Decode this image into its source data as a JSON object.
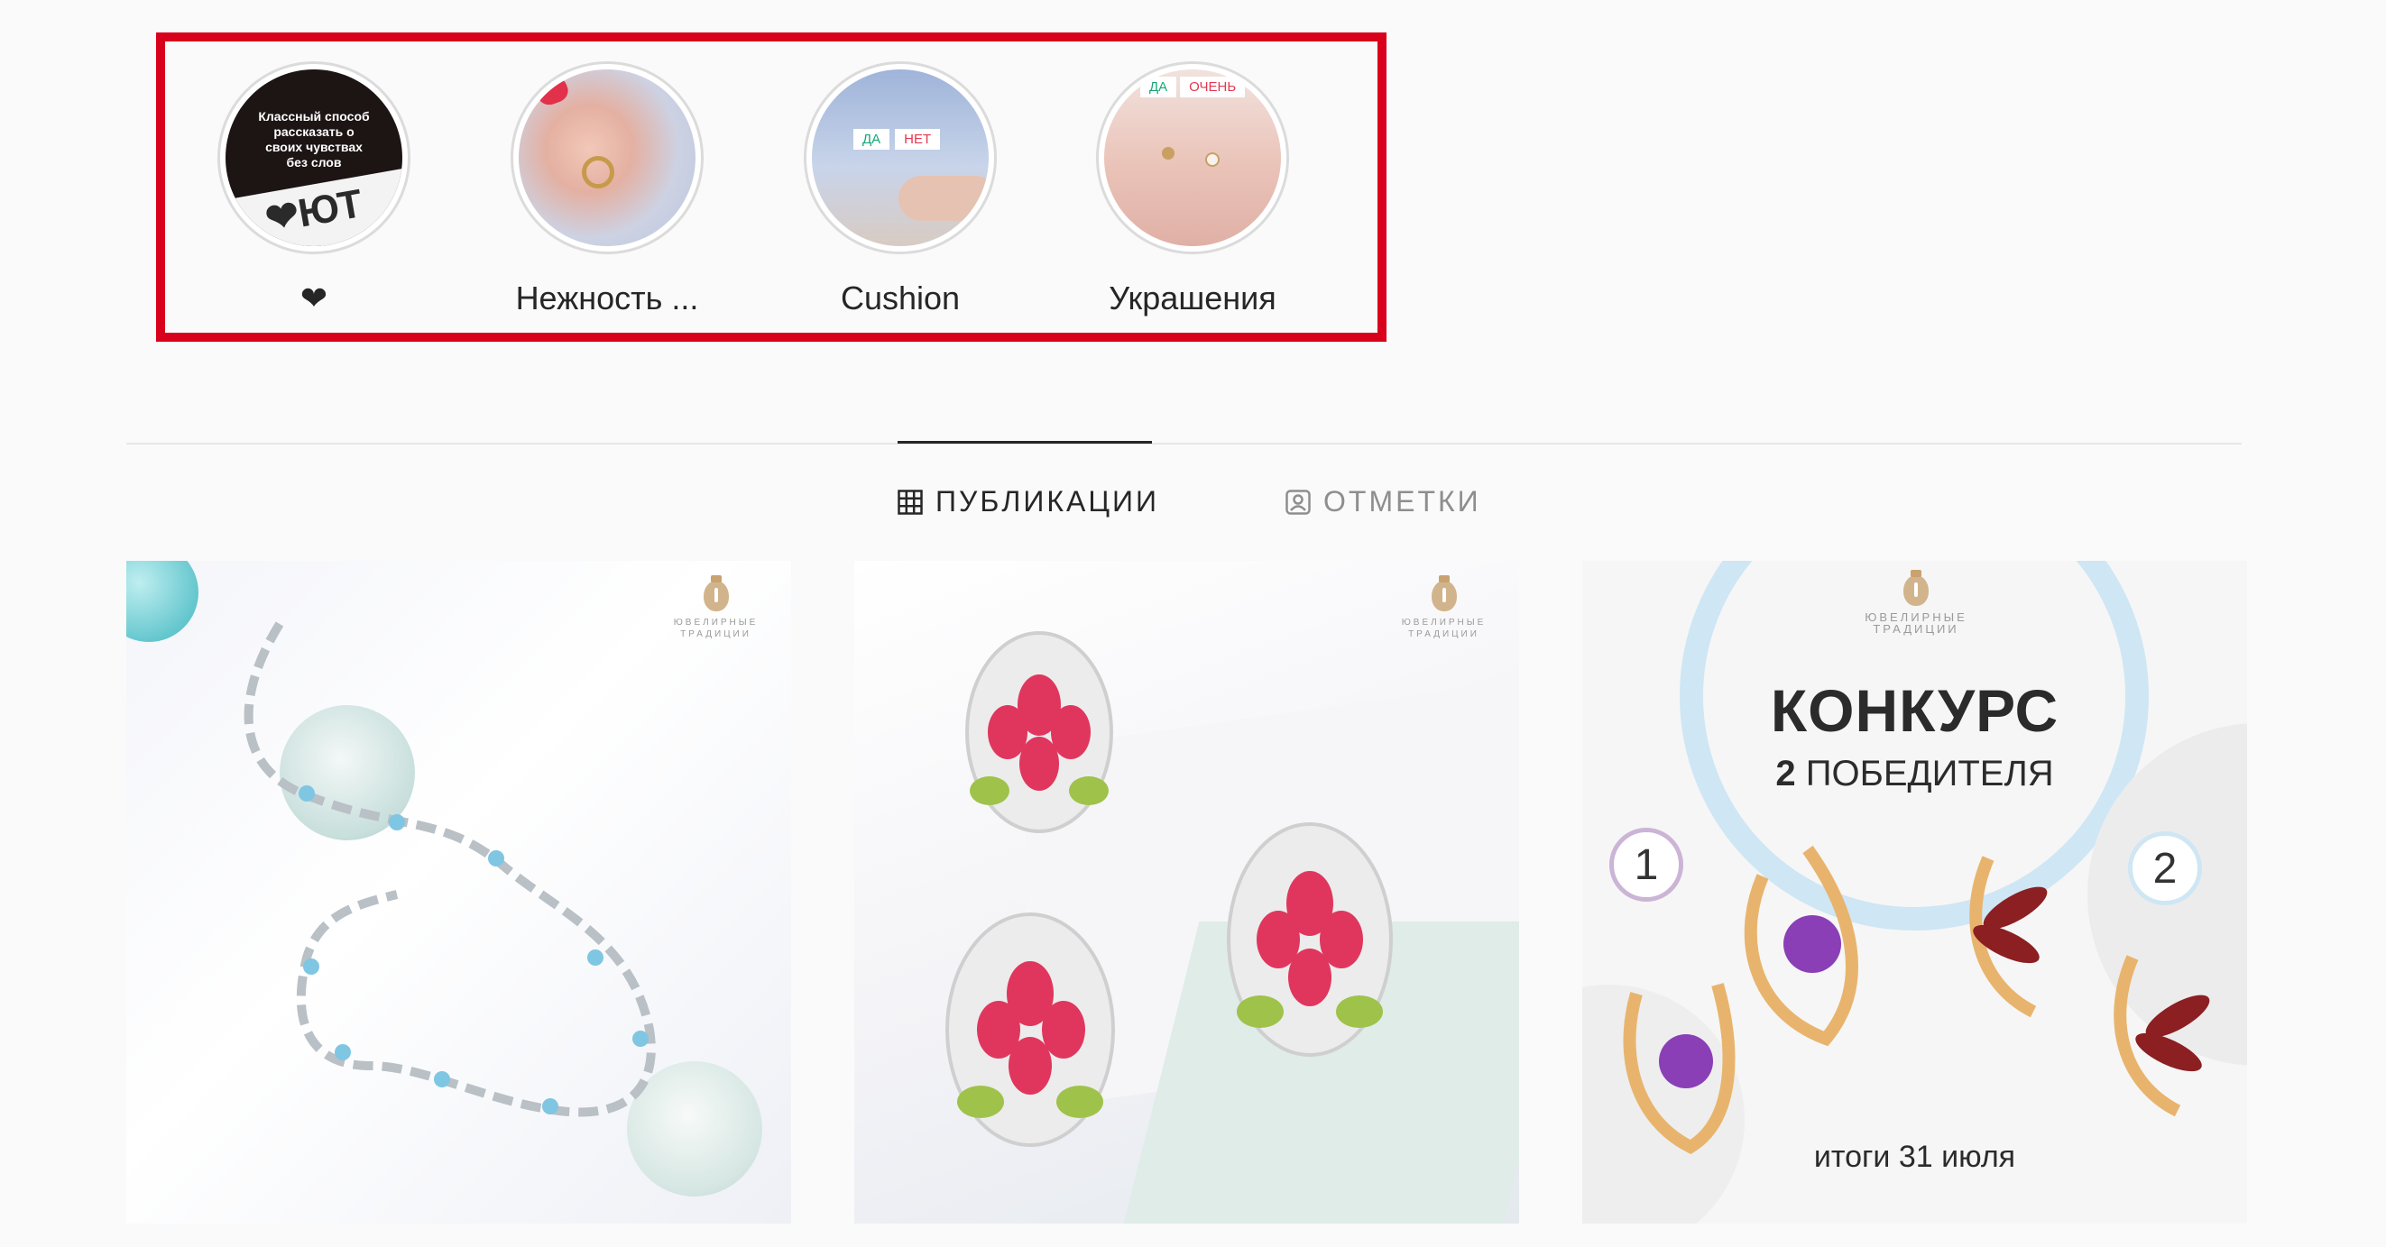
{
  "highlights": [
    {
      "label": "❤",
      "cover_text": "Классный способ рассказать о своих чувствах без слов",
      "cover_badge": "❤ЮТ"
    },
    {
      "label": "Нежность ..."
    },
    {
      "label": "Cushion",
      "cover_poll_yes": "ДА",
      "cover_poll_no": "НЕТ"
    },
    {
      "label": "Украшения",
      "cover_poll_yes": "ДА",
      "cover_poll_other": "ОЧЕНЬ"
    }
  ],
  "tabs": [
    {
      "label": "ПУБЛИКАЦИИ",
      "icon": "grid-icon",
      "active": true
    },
    {
      "label": "ОТМЕТКИ",
      "icon": "tagged-icon",
      "active": false
    }
  ],
  "posts": [
    {
      "brand": "ЮВЕЛИРНЫЕ ТРАДИЦИИ"
    },
    {
      "brand": "ЮВЕЛИРНЫЕ ТРАДИЦИИ"
    },
    {
      "brand": "ЮВЕЛИРНЫЕ ТРАДИЦИИ",
      "title": "КОНКУРС",
      "winners_number": "2",
      "winners_text": "ПОБЕДИТЕЛЯ",
      "badge1": "1",
      "badge2": "2",
      "footer": "итоги 31 июля"
    }
  ],
  "colors": {
    "highlight_box": "#d9001b",
    "text": "#262626",
    "muted": "#8e8e8e"
  }
}
